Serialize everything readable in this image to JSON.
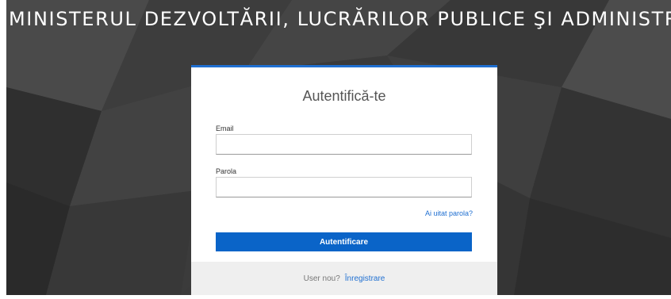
{
  "header": {
    "ministry_title": "MINISTERUL DEZVOLTĂRII, LUCRĂRILOR PUBLICE ŞI ADMINISTRAŢIE"
  },
  "login": {
    "title": "Autentifică-te",
    "email_label": "Email",
    "email_value": "",
    "password_label": "Parola",
    "password_value": "",
    "forgot_password": "Ai uitat parola?",
    "submit_label": "Autentificare",
    "footer_text": "User nou?",
    "register_label": "Înregistrare"
  },
  "colors": {
    "accent": "#1f6fd1",
    "button": "#0a64c8",
    "background": "#3a3a3a",
    "footer": "#efefef"
  }
}
